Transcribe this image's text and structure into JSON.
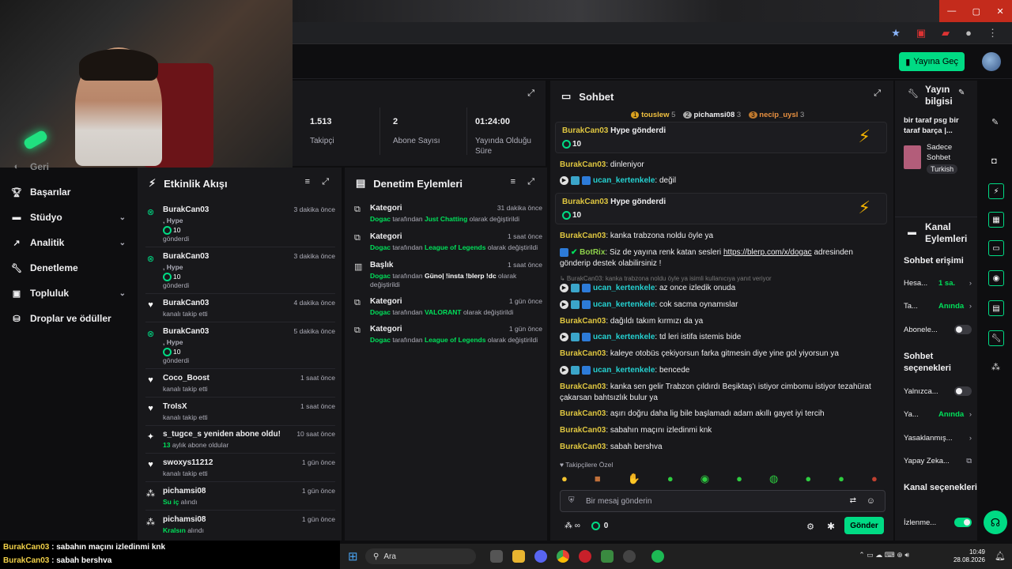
{
  "colors": {
    "accent": "#00db84",
    "bg": "#0e0e10",
    "panel": "#18181b",
    "username_yellow": "#dfc640",
    "username_cyan": "#25d1d1"
  },
  "header": {
    "go_live": "Yayına Geç"
  },
  "left_nav": {
    "partial_top": "Geri",
    "items": [
      {
        "icon": "trophy-icon",
        "label": "Başarılar"
      },
      {
        "icon": "studio-icon",
        "label": "Stüdyo"
      },
      {
        "icon": "analytics-icon",
        "label": "Analitik"
      },
      {
        "icon": "moderation-icon",
        "label": "Denetleme"
      },
      {
        "icon": "community-icon",
        "label": "Topluluk"
      },
      {
        "icon": "drops-icon",
        "label": "Droplar ve ödüller"
      }
    ]
  },
  "stats": [
    {
      "value": "1.513",
      "label": "Takipçi"
    },
    {
      "value": "2",
      "label": "Abone Sayısı"
    },
    {
      "value": "01:24:00",
      "label": "Yayında Olduğu Süre"
    }
  ],
  "activity": {
    "title": "Etkinlik Akışı",
    "items": [
      {
        "icon": "hype-icon",
        "name": "BurakCan03",
        "time": "3 dakika önce",
        "l1": ", Hype",
        "l2": "10",
        "l3": "gönderdi"
      },
      {
        "icon": "hype-icon",
        "name": "BurakCan03",
        "time": "3 dakika önce",
        "l1": ", Hype",
        "l2": "10",
        "l3": "gönderdi"
      },
      {
        "icon": "heart-icon",
        "name": "BurakCan03",
        "time": "4 dakika önce",
        "l1": "kanalı takip etti"
      },
      {
        "icon": "hype-icon",
        "name": "BurakCan03",
        "time": "5 dakika önce",
        "l1": ", Hype",
        "l2": "10",
        "l3": "gönderdi"
      },
      {
        "icon": "heart-icon",
        "name": "Coco_Boost",
        "time": "1 saat önce",
        "l1": "kanalı takip etti"
      },
      {
        "icon": "heart-icon",
        "name": "TroIsX",
        "time": "1 saat önce",
        "l1": "kanalı takip etti"
      },
      {
        "icon": "star-icon",
        "name": "s_tugce_s yeniden abone oldu!",
        "time": "10 saat önce",
        "l1a": "13",
        "l1b": " aylık abone oldular"
      },
      {
        "icon": "heart-icon",
        "name": "swoxys11212",
        "time": "1 gün önce",
        "l1": "kanalı takip etti"
      },
      {
        "icon": "points-icon",
        "name": "pichamsi08",
        "time": "1 gün önce",
        "l1": "Su iç",
        "l1s": " alındı"
      },
      {
        "icon": "points-icon",
        "name": "pichamsi08",
        "time": "1 gün önce",
        "l1": "Kralsın",
        "l1s": " alındı"
      }
    ]
  },
  "moderation": {
    "title": "Denetim Eylemleri",
    "items": [
      {
        "name": "Kategori",
        "time": "31 dakika önce",
        "who": "Dogac",
        "mid": " tarafından ",
        "what": "Just Chatting",
        "end": " olarak değiştirildi"
      },
      {
        "name": "Kategori",
        "time": "1 saat önce",
        "who": "Dogac",
        "mid": " tarafından ",
        "what": "League of Legends",
        "end": " olarak değiştirildi"
      },
      {
        "name": "Başlık",
        "time": "1 saat önce",
        "who": "Dogac",
        "mid": " tarafından ",
        "what": "Güno| !insta !blerp !dc",
        "end": " olarak değiştirildi"
      },
      {
        "name": "Kategori",
        "time": "1 gün önce",
        "who": "Dogac",
        "mid": " tarafından ",
        "what": "VALORANT",
        "end": " olarak değiştirildi"
      },
      {
        "name": "Kategori",
        "time": "1 gün önce",
        "who": "Dogac",
        "mid": " tarafından ",
        "what": "League of Legends",
        "end": " olarak değiştirildi"
      }
    ]
  },
  "chat": {
    "title": "Sohbet",
    "leaderboard": [
      {
        "rank": "1",
        "name": "touslew",
        "count": "5"
      },
      {
        "rank": "2",
        "name": "pichamsi08",
        "count": "3"
      },
      {
        "rank": "3",
        "name": "necip_uysl",
        "count": "3"
      }
    ],
    "hype_label": "BurakCan03",
    "hype_suffix": " Hype gönderdi",
    "hype_value": "10",
    "messages": [
      {
        "user": "BurakCan03",
        "text": ": dinleniyor"
      },
      {
        "user": "ucan_kertenkele",
        "text": ": değil"
      },
      {
        "user": "BurakCan03",
        "text": ": kanka trabzona noldu öyle ya"
      },
      {
        "user": "BotRix",
        "text": ": Siz de yayına renk katan sesleri ",
        "link": "https://blerp.com/x/dogac",
        "after": " adresinden gönderip destek olabilirsiniz !"
      },
      {
        "reply": "↳ BurakCan03: kanka trabzona noldu öyle ya isimli kullanıcıya yanıt veriyor"
      },
      {
        "user": "ucan_kertenkele",
        "text": ": az once izledik onuda"
      },
      {
        "user": "ucan_kertenkele",
        "text": ": cok sacma oynamıslar"
      },
      {
        "user": "BurakCan03",
        "text": ": dağıldı takım kırmızı da ya"
      },
      {
        "user": "ucan_kertenkele",
        "text": ": td leri istifa istemis bide"
      },
      {
        "user": "BurakCan03",
        "text": ": kaleye otobüs çekiyorsun farka gitmesin diye yine gol yiyorsun ya"
      },
      {
        "user": "ucan_kertenkele",
        "text": ": bencede"
      },
      {
        "user": "BurakCan03",
        "text": ": kanka sen gelir Trabzon çıldırdı Beşiktaş'ı istiyor cimbomu istiyor tezahürat çakarsan bahtsızlık bulur ya"
      },
      {
        "user": "BurakCan03",
        "text": ": aşırı doğru daha lig bile başlamadı adam akıllı gayet iyi tercih"
      },
      {
        "user": "BurakCan03",
        "text": ": sabahın maçını izledinmi knk"
      },
      {
        "user": "BurakCan03",
        "text": ": sabah bershva"
      }
    ],
    "followers_only": "♥ Takipçilere Özel",
    "placeholder": "Bir mesaj gönderin",
    "viewers": "0",
    "send": "Gönder"
  },
  "stream_info": {
    "title": "Yayın bilgisi",
    "desc": "bir taraf psg bir taraf barça |...",
    "category": "Sadece Sohbet",
    "tag": "Turkish"
  },
  "channel_actions": {
    "title": "Kanal Eylemleri",
    "chat_access": "Sohbet erişimi",
    "rows1": [
      {
        "label": "Hesa...",
        "value": "1 sa.",
        "kind": "chev"
      },
      {
        "label": "Ta...",
        "value": "Anında",
        "kind": "chev"
      },
      {
        "label": "Abonele...",
        "kind": "toggle_off"
      }
    ],
    "chat_options": "Sohbet seçenekleri",
    "rows2": [
      {
        "label": "Yalnızca...",
        "kind": "toggle_off"
      },
      {
        "label": "Ya...",
        "value": "Anında",
        "kind": "chev"
      },
      {
        "label": "Yasaklanmış...",
        "kind": "chev"
      },
      {
        "label": "Yapay Zeka...",
        "kind": "ext"
      }
    ],
    "channel_options": "Kanal seçenekleri",
    "rows3": [
      {
        "label": "İzlenme...",
        "kind": "toggle_on"
      }
    ]
  },
  "overlay_chat": [
    {
      "user": "BurakCan03",
      "text": " : sabahın maçını izledinmi knk"
    },
    {
      "user": "BurakCan03",
      "text": " : sabah bershva"
    }
  ],
  "taskbar": {
    "search": "Ara",
    "time": "10:49",
    "date": "28.08.2026"
  }
}
